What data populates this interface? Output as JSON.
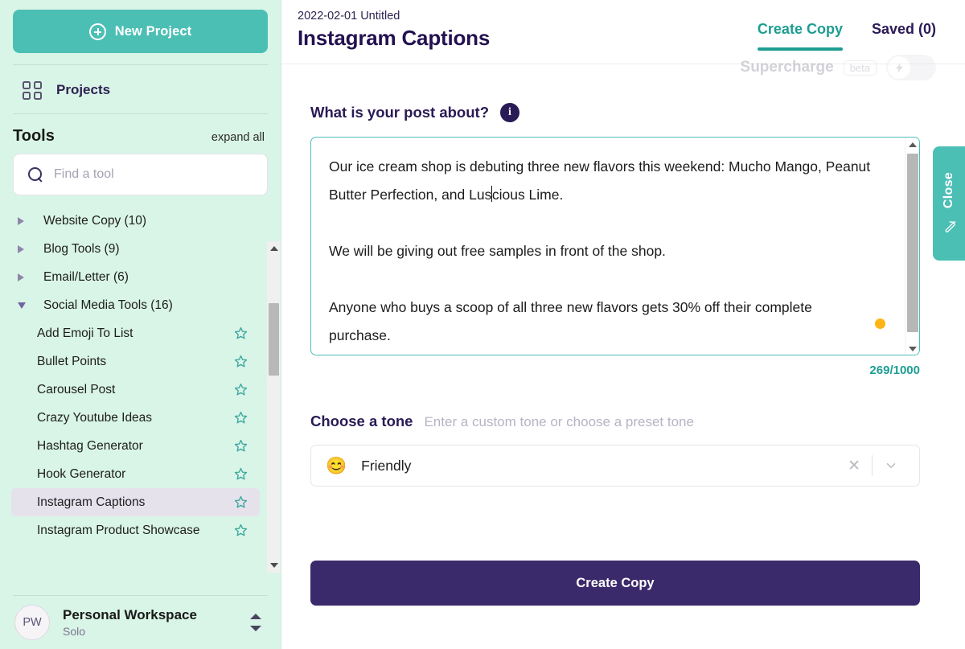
{
  "sidebar": {
    "new_project_label": "New Project",
    "projects_label": "Projects",
    "tools_title": "Tools",
    "expand_all_label": "expand all",
    "search_placeholder": "Find a tool",
    "categories": [
      {
        "label": "Website Copy (10)",
        "expanded": false
      },
      {
        "label": "Blog Tools (9)",
        "expanded": false
      },
      {
        "label": "Email/Letter (6)",
        "expanded": false
      },
      {
        "label": "Social Media Tools (16)",
        "expanded": true
      }
    ],
    "tools": [
      {
        "label": "Add Emoji To List",
        "active": false
      },
      {
        "label": "Bullet Points",
        "active": false
      },
      {
        "label": "Carousel Post",
        "active": false
      },
      {
        "label": "Crazy Youtube Ideas",
        "active": false
      },
      {
        "label": "Hashtag Generator",
        "active": false
      },
      {
        "label": "Hook Generator",
        "active": false
      },
      {
        "label": "Instagram Captions",
        "active": true
      },
      {
        "label": "Instagram Product Showcase",
        "active": false
      }
    ],
    "workspace": {
      "initials": "PW",
      "name": "Personal Workspace",
      "plan": "Solo"
    }
  },
  "header": {
    "breadcrumb": "2022-02-01 Untitled",
    "title": "Instagram Captions",
    "tabs": [
      {
        "label": "Create Copy",
        "active": true
      },
      {
        "label": "Saved (0)",
        "active": false
      }
    ],
    "supercharge": {
      "label": "Supercharge",
      "badge": "beta",
      "enabled": false
    }
  },
  "form": {
    "question_label": "What is your post about?",
    "info_glyph": "i",
    "post_text_before_caret": "Our ice cream shop is debuting three new flavors this weekend: Mucho Mango, Peanut Butter Perfection, and Lus",
    "post_text_after_caret": "cious Lime.\n\nWe will be giving out free samples in front of the shop.\n\nAnyone who buys a scoop of all three new flavors gets 30% off their complete purchase.",
    "char_count": "269/1000",
    "close_tab_label": "Close",
    "tone_label": "Choose a tone",
    "tone_hint": "Enter a custom tone or choose a preset tone",
    "tone_emoji": "😊",
    "tone_value": "Friendly",
    "clear_glyph": "✕",
    "submit_label": "Create Copy"
  },
  "colors": {
    "teal": "#4cbfb5",
    "teal_dark": "#1e9d92",
    "purple": "#3b2a6b",
    "sidebar_bg": "#d9f5e7",
    "accent_dot": "#fdb515"
  }
}
